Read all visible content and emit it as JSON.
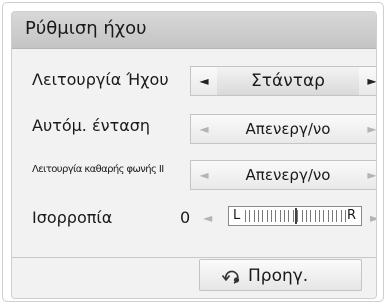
{
  "title": "Ρύθμιση ήχου",
  "rows": [
    {
      "label": "Λειτουργία Ήχου",
      "value": "Στάνταρ"
    },
    {
      "label": "Αυτόμ. ένταση",
      "value": "Απενεργ/νο"
    },
    {
      "label": "Λειτουργία καθαρής φωνής ΙΙ",
      "value": "Απενεργ/νο"
    }
  ],
  "balance": {
    "label": "Ισορροπία",
    "value": "0",
    "left_letter": "L",
    "right_letter": "R",
    "position": 0.5
  },
  "icons": {
    "left": "◄",
    "right": "►",
    "back": "back-arrow-icon"
  },
  "footer": {
    "prev_label": "Προηγ."
  }
}
